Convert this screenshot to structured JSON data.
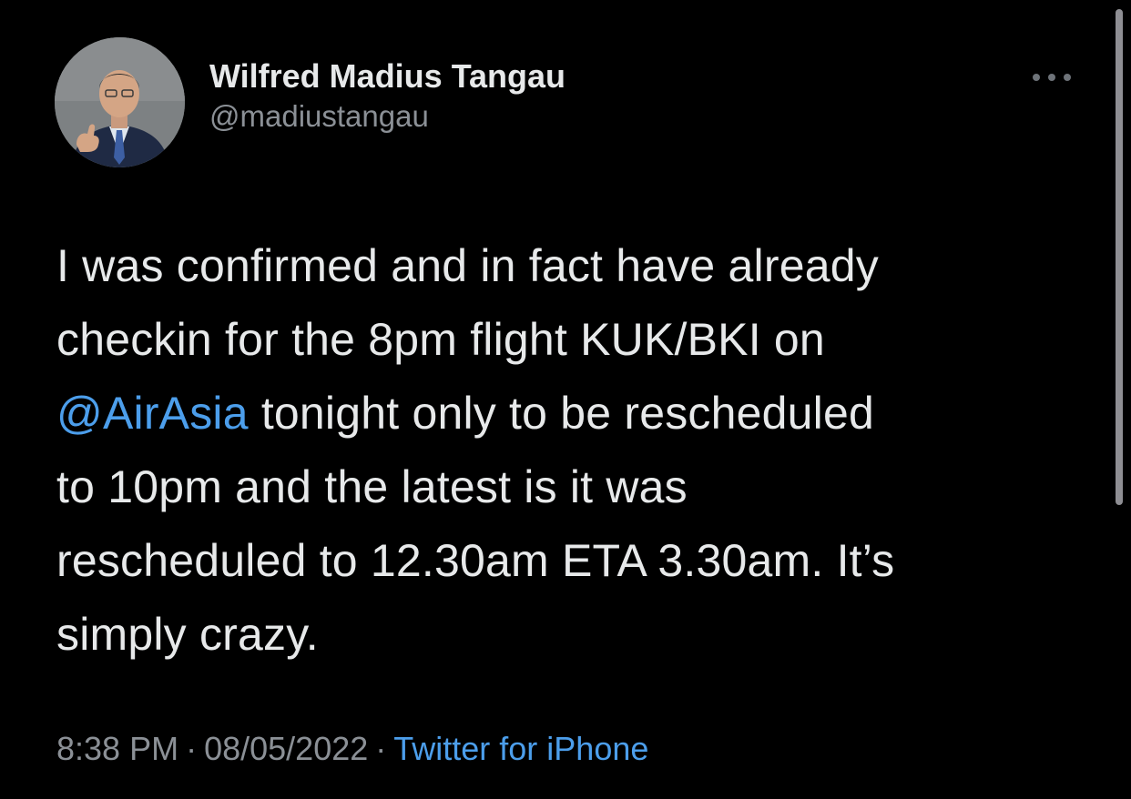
{
  "tweet": {
    "author": {
      "display_name": "Wilfred Madius Tangau",
      "handle": "@madiustangau"
    },
    "more_icon": "more-horizontal-icon",
    "body": {
      "line1": "I was confirmed and in fact have already",
      "line2": "checkin for the 8pm flight KUK/BKI on",
      "line3_mention": "@AirAsia",
      "line3_rest": " tonight only to be rescheduled",
      "line4": "to 10pm and the latest is it was",
      "line5": "rescheduled to 12.30am ETA 3.30am. It’s",
      "line6": "simply crazy."
    },
    "meta": {
      "time": "8:38 PM",
      "separator": "·",
      "date": "08/05/2022",
      "source": "Twitter for iPhone"
    }
  },
  "colors": {
    "background": "#000000",
    "text": "#e7e9ea",
    "secondary": "#8b9096",
    "link": "#4c9eeb"
  }
}
